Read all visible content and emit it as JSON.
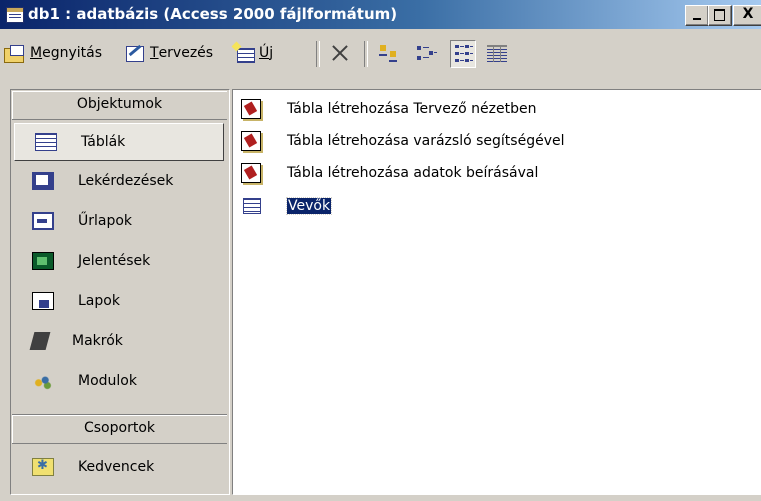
{
  "window": {
    "title": "db1 : adatbázis (Access 2000 fájlformátum)",
    "controls": {
      "minimize": "_",
      "maximize": "□",
      "close": "X"
    }
  },
  "toolbar": {
    "open": {
      "accel": "M",
      "rest": "egnyitás"
    },
    "design": {
      "accel": "T",
      "rest": "ervezés"
    },
    "new": {
      "accel": "Ú",
      "rest": "j"
    },
    "buttons": [
      "delete-icon",
      "large-icons-view",
      "small-icons-view",
      "list-view",
      "details-view"
    ],
    "active_view": "list-view"
  },
  "sidebar": {
    "objects_header": "Objektumok",
    "items": [
      {
        "label": "Táblák",
        "icon": "table-icon",
        "selected": true
      },
      {
        "label": "Lekérdezések",
        "icon": "query-icon"
      },
      {
        "label": "Űrlapok",
        "icon": "form-icon"
      },
      {
        "label": "Jelentések",
        "icon": "report-icon"
      },
      {
        "label": "Lapok",
        "icon": "page-icon"
      },
      {
        "label": "Makrók",
        "icon": "macro-icon"
      },
      {
        "label": "Modulok",
        "icon": "module-icon"
      }
    ],
    "groups_header": "Csoportok",
    "groups": [
      {
        "label": "Kedvencek",
        "icon": "favorites-icon"
      }
    ]
  },
  "content": {
    "items": [
      {
        "label": "Tábla létrehozása Tervező nézetben",
        "icon": "wizard-icon"
      },
      {
        "label": "Tábla létrehozása varázsló segítségével",
        "icon": "wizard-icon"
      },
      {
        "label": "Tábla létrehozása adatok beírásával",
        "icon": "wizard-icon"
      },
      {
        "label": "Vevők",
        "icon": "table-icon",
        "selected": true
      }
    ]
  },
  "colors": {
    "titlebar_start": "#0a246a",
    "titlebar_end": "#a6caf0",
    "face": "#d4d0c8",
    "selection": "#0a246a"
  }
}
